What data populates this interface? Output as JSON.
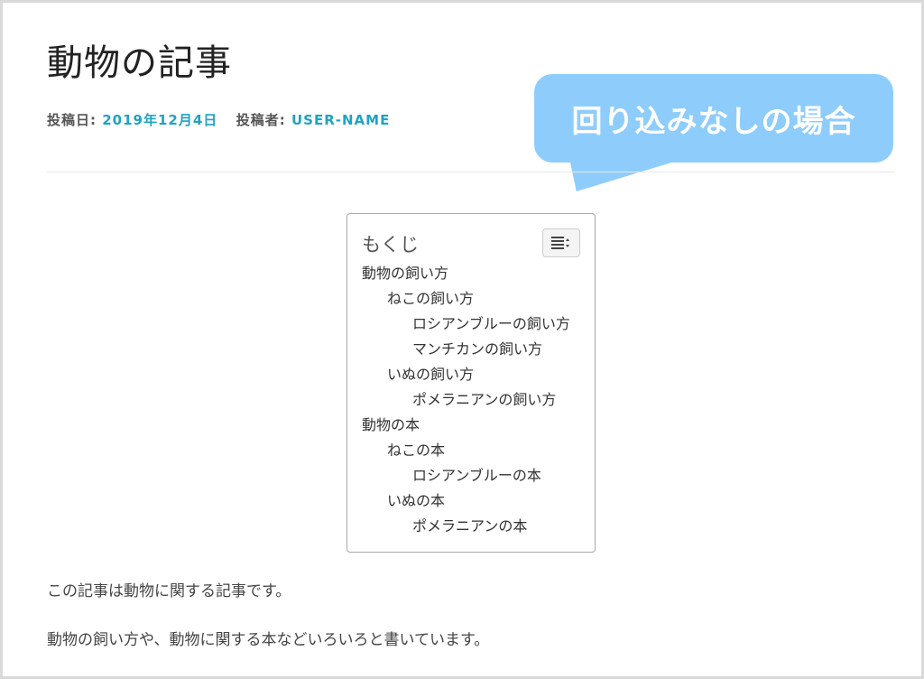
{
  "post": {
    "title": "動物の記事",
    "posted_on_label": "投稿日:",
    "date": "2019年12月4日",
    "posted_by_label": "投稿者:",
    "author": "USER-NAME",
    "paragraphs": [
      "この記事は動物に関する記事です。",
      "動物の飼い方や、動物に関する本などいろいろと書いています。"
    ]
  },
  "callout": {
    "text": "回り込みなしの場合",
    "color": "#8ecdfb"
  },
  "toc": {
    "title": "もくじ",
    "toggle_icon": "list-toggle-icon",
    "items": [
      {
        "label": "動物の飼い方",
        "level": 1
      },
      {
        "label": "ねこの飼い方",
        "level": 2
      },
      {
        "label": "ロシアンブルーの飼い方",
        "level": 3
      },
      {
        "label": "マンチカンの飼い方",
        "level": 3
      },
      {
        "label": "いぬの飼い方",
        "level": 2
      },
      {
        "label": "ポメラニアンの飼い方",
        "level": 3
      },
      {
        "label": "動物の本",
        "level": 1
      },
      {
        "label": "ねこの本",
        "level": 2
      },
      {
        "label": "ロシアンブルーの本",
        "level": 3
      },
      {
        "label": "いぬの本",
        "level": 2
      },
      {
        "label": "ポメラニアンの本",
        "level": 3
      }
    ]
  },
  "colors": {
    "link": "#1fa3c4",
    "frame": "#d9d9d9"
  }
}
